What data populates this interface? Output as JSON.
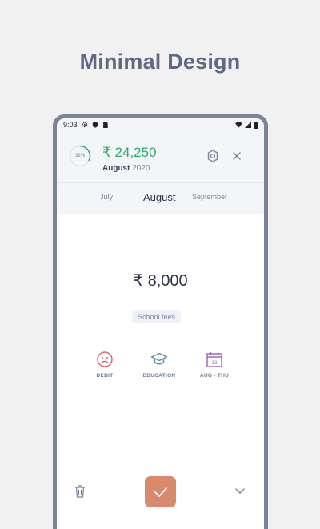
{
  "headline": "Minimal Design",
  "status_bar": {
    "time": "9:03",
    "left_icons": [
      "gear-icon",
      "shield-icon",
      "sim-card-icon"
    ],
    "right_icons": [
      "wifi-icon",
      "signal-icon",
      "battery-icon"
    ]
  },
  "header": {
    "progress_percent": 32,
    "progress_label": "32%",
    "amount": "₹ 24,250",
    "month": "August",
    "year": "2020"
  },
  "tabs": [
    {
      "label": "July",
      "active": false
    },
    {
      "label": "August",
      "active": true
    },
    {
      "label": "September",
      "active": false
    }
  ],
  "entry": {
    "amount": "₹ 8,000",
    "note": "School fees"
  },
  "categories": [
    {
      "label": "DEBIT",
      "icon": "sad-face-icon",
      "color": "#d46a6a"
    },
    {
      "label": "EDUCATION",
      "icon": "graduation-cap-icon",
      "color": "#5b8fb0"
    },
    {
      "label": "AUG - THU",
      "icon": "calendar-icon",
      "day": "13",
      "color": "#a06ab8"
    }
  ],
  "colors": {
    "accent_green": "#2eaa6a",
    "confirm_button": "#d98a6c",
    "phone_frame": "#7a8599"
  }
}
